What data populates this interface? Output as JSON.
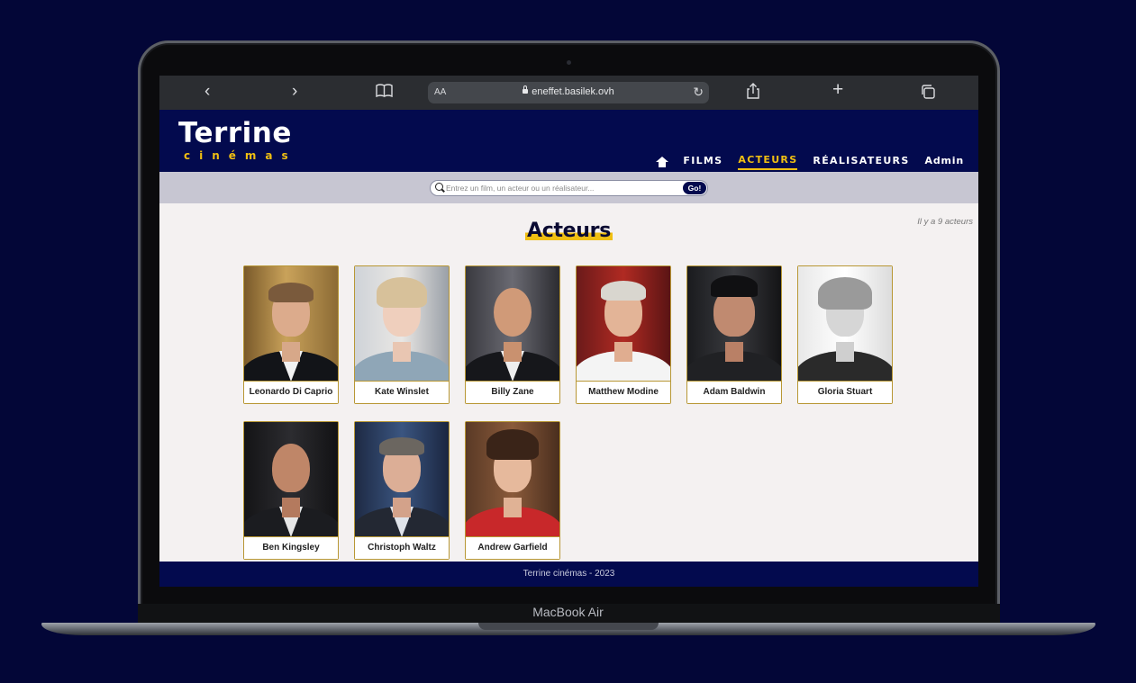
{
  "device": {
    "label": "MacBook Air"
  },
  "browser": {
    "aa_label": "AA",
    "url": "eneffet.basilek.ovh"
  },
  "site": {
    "logo": {
      "main": "Terrine",
      "sub": "cinémas"
    },
    "nav": {
      "films": "FILMS",
      "acteurs": "ACTEURS",
      "realisateurs": "RÉALISATEURS",
      "admin": "Admin"
    },
    "search": {
      "placeholder": "Entrez un film, un acteur ou un réalisateur...",
      "button": "Go!"
    },
    "page_title": "Acteurs",
    "count_text": "Il y a 9 acteurs",
    "actors": [
      {
        "name": "Leonardo Di Caprio"
      },
      {
        "name": "Kate Winslet"
      },
      {
        "name": "Billy Zane"
      },
      {
        "name": "Matthew Modine"
      },
      {
        "name": "Adam Baldwin"
      },
      {
        "name": "Gloria Stuart"
      },
      {
        "name": "Ben Kingsley"
      },
      {
        "name": "Christoph Waltz"
      },
      {
        "name": "Andrew Garfield"
      }
    ],
    "footer": "Terrine cinémas - 2023"
  },
  "colors": {
    "page_background": "#030637",
    "header": "#030a4e",
    "accent": "#f0bf12",
    "search_band": "#c7c6d2",
    "content_background": "#f4f1f1"
  }
}
